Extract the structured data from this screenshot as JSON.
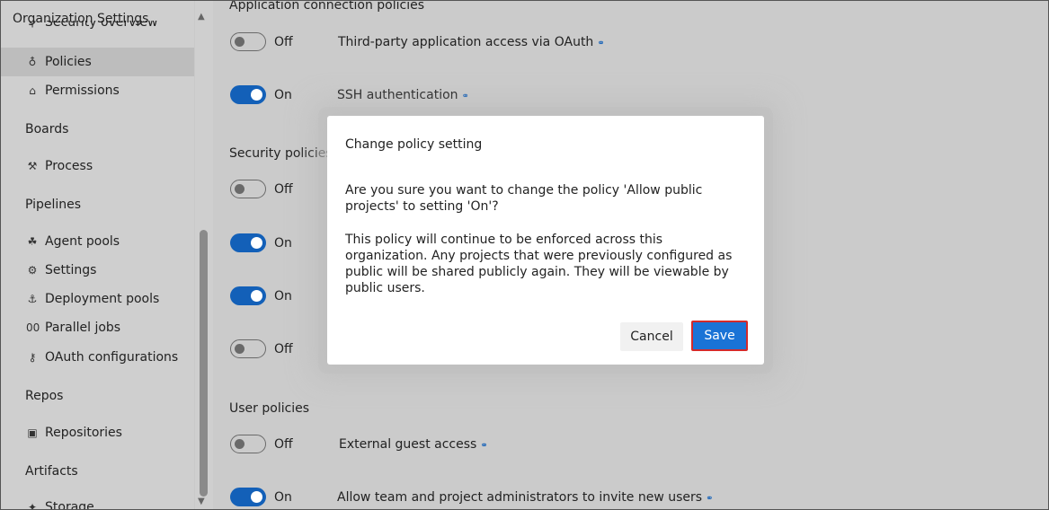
{
  "sidebar": {
    "header": "Organization Settings",
    "partial_item": "Security overview",
    "items": [
      {
        "label": "Policies",
        "icon": "lightbulb-icon",
        "glyph": "♁"
      },
      {
        "label": "Permissions",
        "icon": "lock-icon",
        "glyph": "⌂"
      },
      {
        "label": "Process",
        "icon": "process-icon",
        "glyph": "⚒"
      },
      {
        "label": "Agent pools",
        "icon": "agent-pools-icon",
        "glyph": "☘"
      },
      {
        "label": "Settings",
        "icon": "gear-icon",
        "glyph": "⚙"
      },
      {
        "label": "Deployment pools",
        "icon": "deployment-pools-icon",
        "glyph": "⚓"
      },
      {
        "label": "Parallel jobs",
        "icon": "parallel-jobs-icon",
        "glyph": "00"
      },
      {
        "label": "OAuth configurations",
        "icon": "key-icon",
        "glyph": "⚷"
      },
      {
        "label": "Repositories",
        "icon": "repository-icon",
        "glyph": "▣"
      },
      {
        "label": "Storage",
        "icon": "storage-icon",
        "glyph": "✦"
      }
    ],
    "groups": [
      "Boards",
      "Pipelines",
      "Repos",
      "Artifacts"
    ]
  },
  "main": {
    "sections": {
      "app_connection": "Application connection policies",
      "security": "Security policies",
      "user": "User policies"
    },
    "toggles": [
      {
        "state": "Off",
        "policy": "Third-party application access via OAuth"
      },
      {
        "state": "On",
        "policy": "SSH authentication"
      },
      {
        "state": "Off",
        "policy": ""
      },
      {
        "state": "On",
        "policy": ""
      },
      {
        "state": "On",
        "policy": ""
      },
      {
        "state": "Off",
        "policy": ""
      },
      {
        "state": "Off",
        "policy": "External guest access"
      },
      {
        "state": "On",
        "policy": "Allow team and project administrators to invite new users"
      }
    ]
  },
  "dialog": {
    "title": "Change policy setting",
    "question": "Are you sure you want to change the policy 'Allow public projects' to setting 'On'?",
    "body": "This policy will continue to be enforced across this organization. Any projects that were previously configured as public will be shared publicly again. They will be viewable by public users.",
    "cancel_label": "Cancel",
    "save_label": "Save"
  },
  "colors": {
    "accent": "#1360b8",
    "save_button": "#1a73d6",
    "highlight_border": "#d42a2a"
  }
}
